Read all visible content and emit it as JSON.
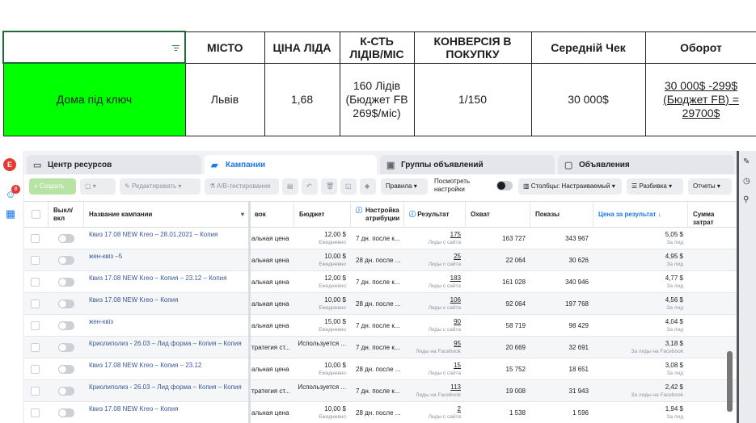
{
  "sheet": {
    "headers": [
      "",
      "МІСТО",
      "ЦІНА ЛІДА",
      "К-СТЬ ЛІДІВ/МІС",
      "КОНВЕРСІЯ В ПОКУПКУ",
      "Середній Чек",
      "Оборот"
    ],
    "row": [
      "Дома під ключ",
      "Львів",
      "1,68",
      "160 Лідів (Бюджет FB 269$/міс)",
      "1/150",
      "30 000$",
      "30 000$ -299$ (Бюджет FB) = 29700$"
    ],
    "highlight_color": "#00ff00"
  },
  "fb": {
    "avatar_letter": "E",
    "notif_count": "8",
    "tabs": [
      "Центр ресурсов",
      "Кампании",
      "Группы объявлений",
      "Объявления"
    ],
    "toolbar": {
      "create": "+ Создать",
      "edit": "Редактировать",
      "ab": "A/B-тестирование",
      "rules": "Правила",
      "view_settings": "Посмотреть настройки",
      "columns": "Столбцы: Настраиваемый",
      "breakdown": "Разбивка",
      "reports": "Отчеты"
    },
    "headers": {
      "toggle": "Выкл/вкл",
      "name": "Название кампании",
      "bid": "вок",
      "budget": "Бюджет",
      "attr": "Настройка атрибуции",
      "result": "Результат",
      "reach": "Охват",
      "impr": "Показы",
      "cpr": "Цена за результат",
      "spent": "Сумма затрат"
    },
    "rows": [
      {
        "name": "Квиз 17.08 NEW Kreo – 28.01.2021 – Копия",
        "bid": "альная цена",
        "budget": "12,00 $",
        "period": "Ежедневно",
        "attr": "7 дн. после к...",
        "result": "175",
        "rsub": "Лиды с сайта",
        "reach": "163 727",
        "impr": "343 967",
        "cpr": "5,05 $",
        "csub": "За лид"
      },
      {
        "name": "жен-квіз –5",
        "bid": "альная цена",
        "budget": "10,00 $",
        "period": "Ежедневно",
        "attr": "28 дн. после ...",
        "result": "25",
        "rsub": "Лиды с сайта",
        "reach": "22 064",
        "impr": "30 626",
        "cpr": "4,95 $",
        "csub": "За лид"
      },
      {
        "name": "Квиз 17.08 NEW Kreo – Копия – 23.12 – Копия",
        "bid": "альная цена",
        "budget": "12,00 $",
        "period": "Ежедневно",
        "attr": "7 дн. после к...",
        "result": "183",
        "rsub": "Лиды с сайта",
        "reach": "161 028",
        "impr": "340 946",
        "cpr": "4,77 $",
        "csub": "За лид"
      },
      {
        "name": "Квиз 17.08 NEW Kreo – Копия",
        "bid": "альная цена",
        "budget": "10,00 $",
        "period": "Ежедневно",
        "attr": "28 дн. после ...",
        "result": "106",
        "rsub": "Лиды с сайта",
        "reach": "92 064",
        "impr": "197 768",
        "cpr": "4,56 $",
        "csub": "За лид"
      },
      {
        "name": "жен-квіз",
        "bid": "альная цена",
        "budget": "15,00 $",
        "period": "Ежедневно",
        "attr": "7 дн. после к...",
        "result": "90",
        "rsub": "Лиды с сайта",
        "reach": "58 719",
        "impr": "98 429",
        "cpr": "4,04 $",
        "csub": "За лид"
      },
      {
        "name": "Криолиполиз - 26.03 – Лид форма – Копия – Копия",
        "bid": "тратегия ст...",
        "budget": "Используется ...",
        "period": "",
        "attr": "7 дн. после к...",
        "result": "95",
        "rsub": "Лиды на Facebook",
        "reach": "20 669",
        "impr": "32 691",
        "cpr": "3,18 $",
        "csub": "За лиды на Facebook"
      },
      {
        "name": "Квиз 17.08 NEW Kreo – Копия – 23.12",
        "bid": "альная цена",
        "budget": "10,00 $",
        "period": "Ежедневно",
        "attr": "28 дн. после ...",
        "result": "15",
        "rsub": "Лиды с сайта",
        "reach": "15 752",
        "impr": "18 651",
        "cpr": "3,08 $",
        "csub": "За лид"
      },
      {
        "name": "Криолиполиз - 26.03 – Лид форма – Копия – Копия",
        "bid": "тратегия ст...",
        "budget": "Используется ...",
        "period": "",
        "attr": "7 дн. после к...",
        "result": "113",
        "rsub": "Лиды на Facebook",
        "reach": "19 008",
        "impr": "31 943",
        "cpr": "2,42 $",
        "csub": "За лиды на Facebook"
      },
      {
        "name": "Квиз 17.08 NEW Kreo – Копия",
        "bid": "альная цена",
        "budget": "10,00 $",
        "period": "Ежедневно",
        "attr": "28 дн. после ...",
        "result": "2",
        "rsub": "Лиды с сайта",
        "reach": "1 538",
        "impr": "1 596",
        "cpr": "1,94 $",
        "csub": "За лид"
      }
    ]
  }
}
